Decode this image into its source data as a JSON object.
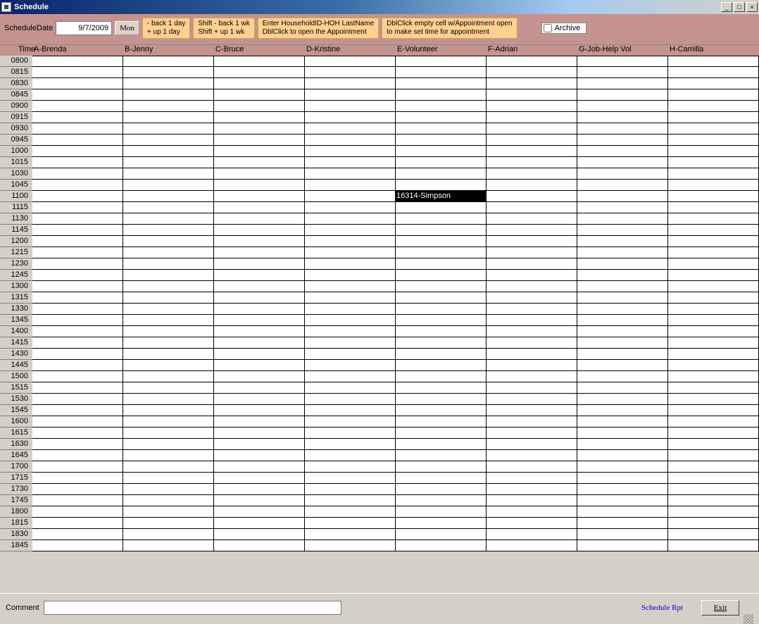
{
  "window": {
    "title": "Schedule"
  },
  "toolbar": {
    "date_label": "ScheduleDate",
    "date_value": "9/7/2009",
    "day_button": "Mon",
    "tip1_line1": "- back 1 day",
    "tip1_line2": "+ up 1 day",
    "tip2_line1": "Shift - back 1 wk",
    "tip2_line2": "Shift + up 1 wk",
    "tip3_line1": "Enter HouseholdID-HOH LastName",
    "tip3_line2": "DblClick to open the Appointment",
    "tip4_line1": "DblClick empty cell w/Appointment open",
    "tip4_line2": "to make set time for appointment",
    "archive_label": "Archive",
    "archive_checked": false
  },
  "columns": [
    "A-Brenda",
    "B-Jenny",
    "C-Bruce",
    "D-Kristine",
    "E-Volunteer",
    "F-Adrian",
    "G-Job-Help Vol",
    "H-Camilla"
  ],
  "time_header": "Time",
  "times": [
    "0800",
    "0815",
    "0830",
    "0845",
    "0900",
    "0915",
    "0930",
    "0945",
    "1000",
    "1015",
    "1030",
    "1045",
    "1100",
    "1115",
    "1130",
    "1145",
    "1200",
    "1215",
    "1230",
    "1245",
    "1300",
    "1315",
    "1330",
    "1345",
    "1400",
    "1415",
    "1430",
    "1445",
    "1500",
    "1515",
    "1530",
    "1545",
    "1600",
    "1615",
    "1630",
    "1645",
    "1700",
    "1715",
    "1730",
    "1745",
    "1800",
    "1815",
    "1830",
    "1845"
  ],
  "appointments": {
    "1100": {
      "col": 4,
      "text": "16314-Simpson"
    }
  },
  "footer": {
    "comment_label": "Comment",
    "comment_value": "",
    "schedule_rpt": "Schedule Rpt",
    "exit": "Exit"
  }
}
